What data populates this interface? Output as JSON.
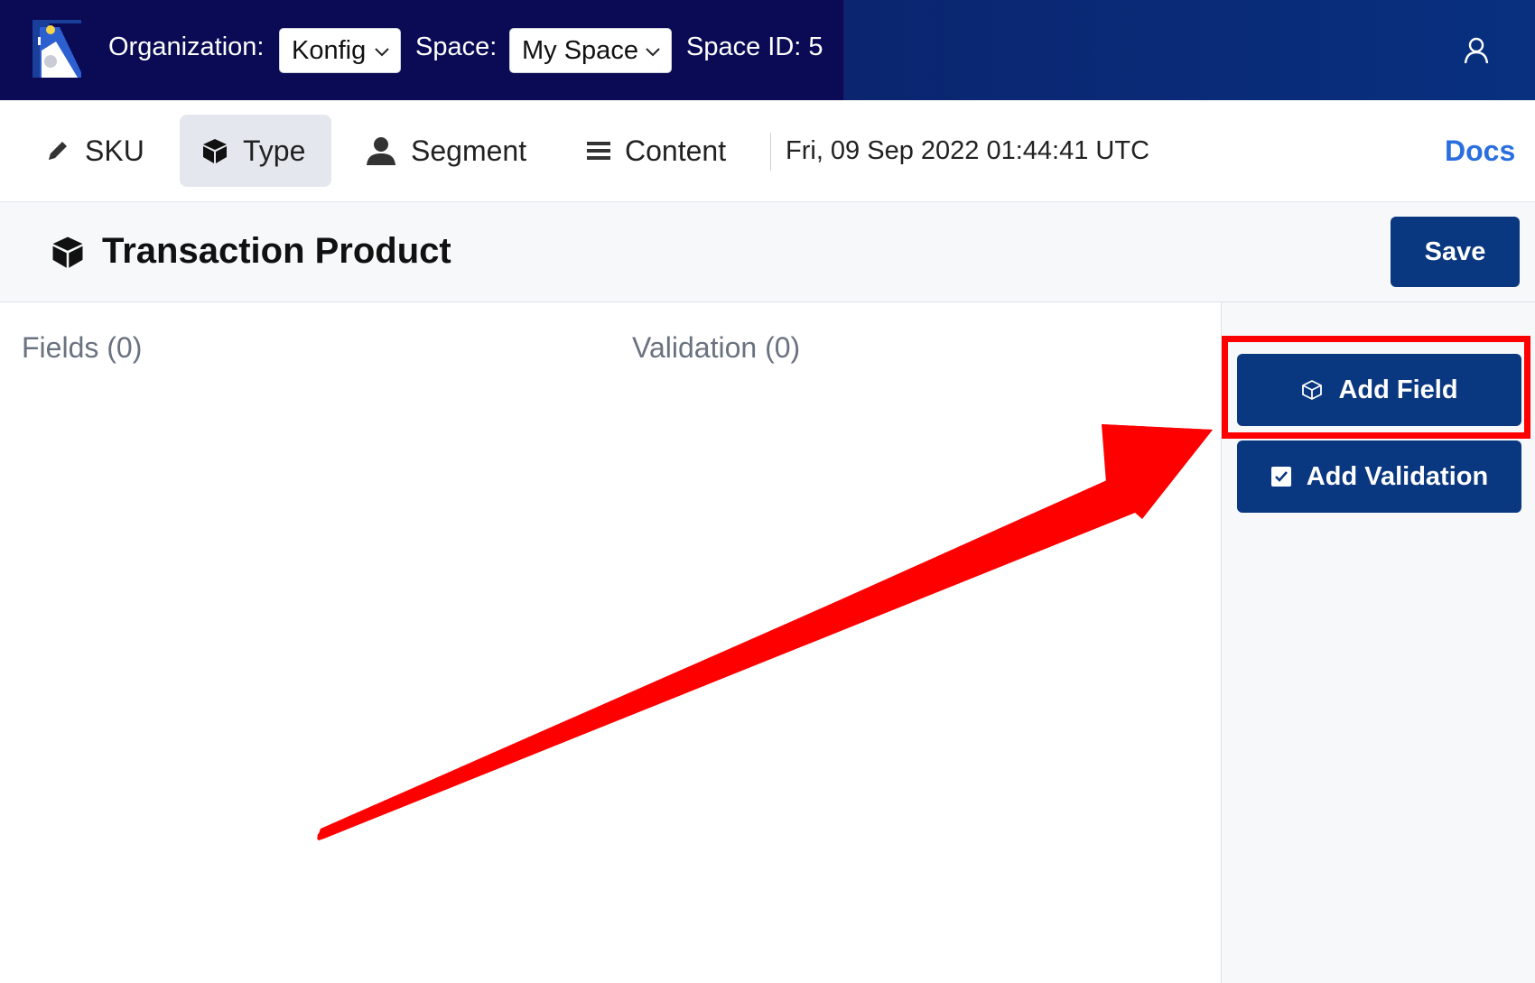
{
  "topbar": {
    "org_label": "Organization:",
    "org_value": "Konfig",
    "space_label": "Space:",
    "space_value": "My Space",
    "space_id": "Space ID: 5"
  },
  "tabs": [
    {
      "label": "SKU",
      "icon": "pencil-icon"
    },
    {
      "label": "Type",
      "icon": "cube-icon",
      "active": true
    },
    {
      "label": "Segment",
      "icon": "person-icon"
    },
    {
      "label": "Content",
      "icon": "list-icon"
    }
  ],
  "timestamp": "Fri, 09 Sep 2022 01:44:41 UTC",
  "docs_label": "Docs",
  "header": {
    "title": "Transaction Product",
    "save_label": "Save"
  },
  "main": {
    "fields_label": "Fields (0)",
    "validation_label": "Validation (0)"
  },
  "sidebar": {
    "add_field_label": "Add Field",
    "add_validation_label": "Add Validation"
  },
  "colors": {
    "topbar": "#0a0a55",
    "primary_button": "#0a3880",
    "docs_link": "#2a6fe0",
    "annotation": "#ff0000"
  }
}
